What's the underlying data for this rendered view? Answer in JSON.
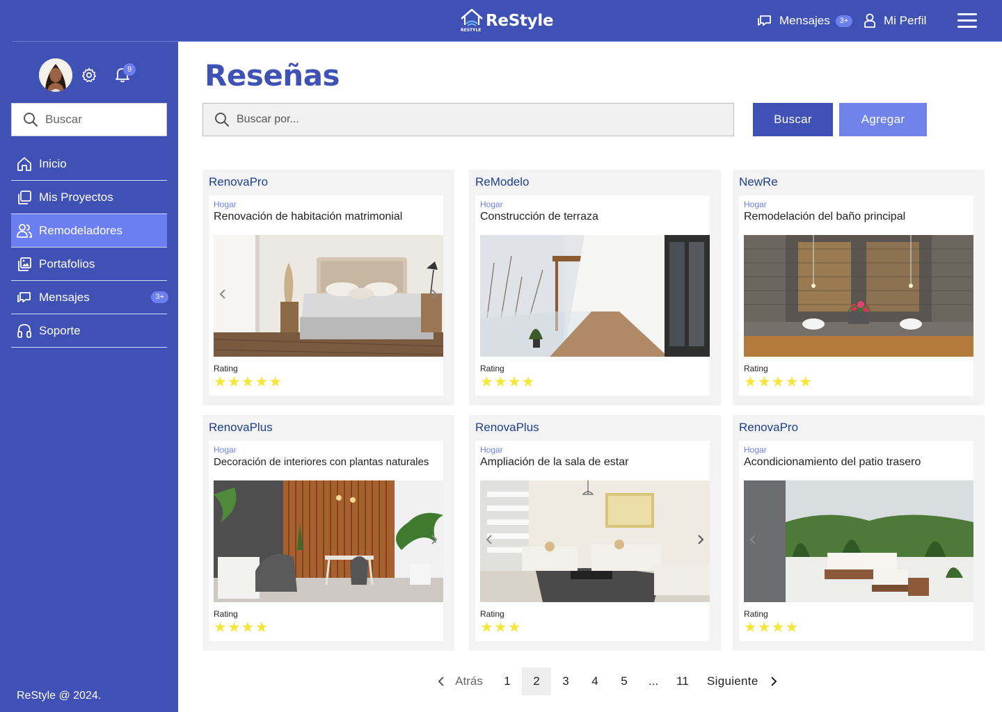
{
  "brand": {
    "name": "ReStyle",
    "tagline": "RESTYLE"
  },
  "topnav": {
    "messages_label": "Mensajes",
    "messages_badge": "3+",
    "profile_label": "Mi Perfil"
  },
  "sidebar": {
    "notifications_count": "9",
    "search_placeholder": "Buscar",
    "items": [
      {
        "label": "Inicio",
        "icon": "home-icon"
      },
      {
        "label": "Mis Proyectos",
        "icon": "projects-icon"
      },
      {
        "label": "Remodeladores",
        "icon": "users-icon",
        "active": true
      },
      {
        "label": "Portafolios",
        "icon": "gallery-icon"
      },
      {
        "label": "Mensajes",
        "icon": "messages-icon",
        "badge": "3+"
      },
      {
        "label": "Soporte",
        "icon": "headset-icon"
      }
    ],
    "footer": "ReStyle @ 2024."
  },
  "main": {
    "title": "Reseñas",
    "search_placeholder": "Buscar por...",
    "search_button": "Buscar",
    "add_button": "Agregar",
    "rating_label": "Rating",
    "reviews": [
      {
        "company": "RenovaPro",
        "category": "Hogar",
        "title": "Renovación de habitación matrimonial",
        "stars": "★★★★★",
        "rating": 5
      },
      {
        "company": "ReModelo",
        "category": "Hogar",
        "title": "Construcción de terraza",
        "stars": "★★★★",
        "rating": 4
      },
      {
        "company": "NewRe",
        "category": "Hogar",
        "title": "Remodelación del baño principal",
        "stars": "★★★★★",
        "rating": 5
      },
      {
        "company": "RenovaPlus",
        "category": "Hogar",
        "title": "Decoración de interiores con plantas naturales",
        "stars": "★★★★",
        "rating": 4
      },
      {
        "company": "RenovaPlus",
        "category": "Hogar",
        "title": "Ampliación de la sala de estar",
        "stars": "★★★",
        "rating": 3
      },
      {
        "company": "RenovaPro",
        "category": "Hogar",
        "title": "Acondicionamiento del patio trasero",
        "stars": "★★★★",
        "rating": 4
      }
    ]
  },
  "pagination": {
    "prev": "Atrás",
    "next": "Siguiente",
    "pages": [
      "1",
      "2",
      "3",
      "4",
      "5",
      "...",
      "11"
    ],
    "current": "2"
  },
  "colors": {
    "primary": "#3f51b5",
    "accent": "#6c7ff0",
    "star": "#f5e63a",
    "company_text": "#1d3f8f"
  }
}
